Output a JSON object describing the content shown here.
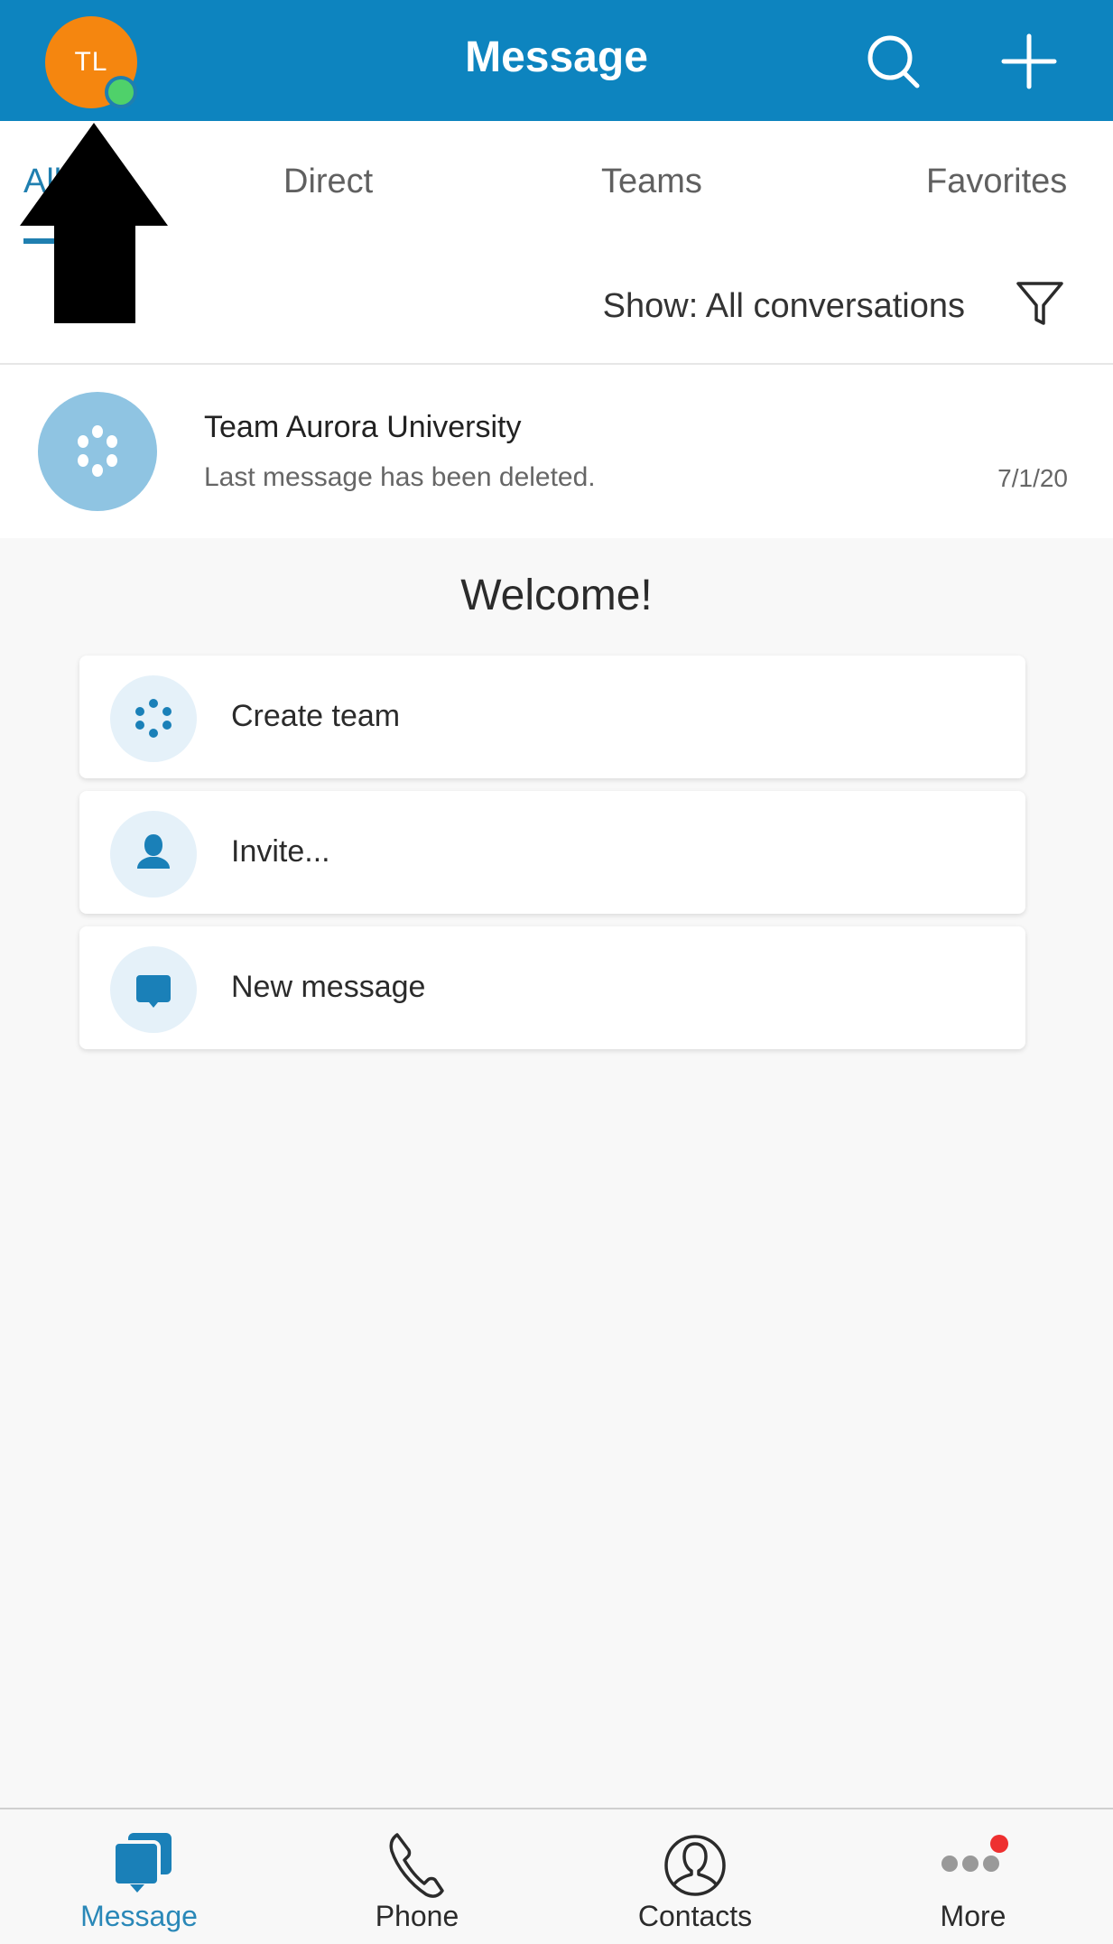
{
  "header": {
    "title": "Message",
    "avatar_initials": "TL",
    "avatar_color": "#f5860f",
    "presence_color": "#4fd16a",
    "brand_color": "#0d84bf",
    "search_icon": "search-icon",
    "add_icon": "plus-icon"
  },
  "tabs": [
    {
      "label": "All",
      "active": true
    },
    {
      "label": "Direct",
      "active": false
    },
    {
      "label": "Teams",
      "active": false
    },
    {
      "label": "Favorites",
      "active": false
    }
  ],
  "filter": {
    "label": "Show: All conversations",
    "icon": "filter-icon"
  },
  "conversations": [
    {
      "name": "Team Aurora University",
      "last_message": "Last message has been deleted.",
      "date": "7/1/20",
      "icon": "team-icon"
    }
  ],
  "welcome": {
    "heading": "Welcome!",
    "actions": [
      {
        "label": "Create team",
        "icon": "team-icon"
      },
      {
        "label": "Invite...",
        "icon": "person-icon"
      },
      {
        "label": "New message",
        "icon": "chat-bubble-icon"
      }
    ]
  },
  "bottom_nav": {
    "items": [
      {
        "label": "Message",
        "icon": "messages-icon",
        "active": true
      },
      {
        "label": "Phone",
        "icon": "phone-icon",
        "active": false
      },
      {
        "label": "Contacts",
        "icon": "contacts-icon",
        "active": false
      },
      {
        "label": "More",
        "icon": "more-icon",
        "active": false,
        "badge": true
      }
    ],
    "badge_color": "#ee3030"
  },
  "annotation": {
    "type": "arrow-up",
    "target": "avatar"
  }
}
